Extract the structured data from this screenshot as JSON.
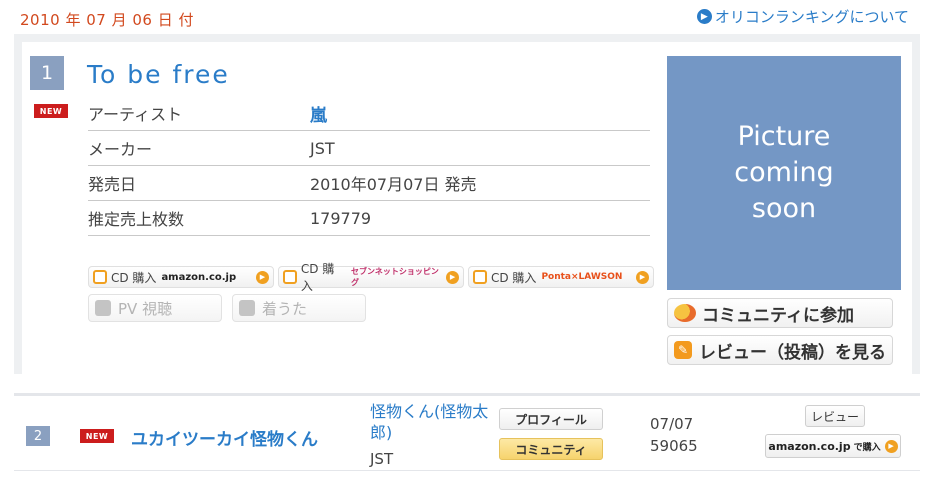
{
  "header": {
    "date": "2010 年 07 月 06 日 付",
    "about_link": "オリコンランキングについて"
  },
  "entry1": {
    "rank": "1",
    "new_badge": "NEW",
    "title": "To be free",
    "info": [
      {
        "key": "アーティスト",
        "value": "嵐"
      },
      {
        "key": "メーカー",
        "value": "JST"
      },
      {
        "key": "発売日",
        "value": "2010年07月07日 発売"
      },
      {
        "key": "推定売上枚数",
        "value": "179779"
      }
    ],
    "buy_buttons": [
      {
        "label": "CD 購入",
        "shop": "amazon.co.jp"
      },
      {
        "label": "CD 購入",
        "shop": "セブンネットショッピング"
      },
      {
        "label": "CD 購入",
        "shop": "Ponta×LAWSON"
      }
    ],
    "pv_label": "PV 視聴",
    "chaku_label": "着うた",
    "picture_lines": [
      "Picture",
      "coming",
      "soon"
    ],
    "community_label": "コミュニティに参加",
    "review_label": "レビュー（投稿）を見る"
  },
  "entry2": {
    "rank": "2",
    "new_badge": "NEW",
    "title": "ユカイツーカイ怪物くん",
    "artist": "怪物くん(怪物太郎)",
    "maker": "JST",
    "profile_label": "プロフィール",
    "community_label": "コミュニティ",
    "release_date": "07/07",
    "sales": "59065",
    "review_label": "レビュー",
    "amazon_shop": "amazon.co.jp",
    "amazon_label": "で購入"
  }
}
